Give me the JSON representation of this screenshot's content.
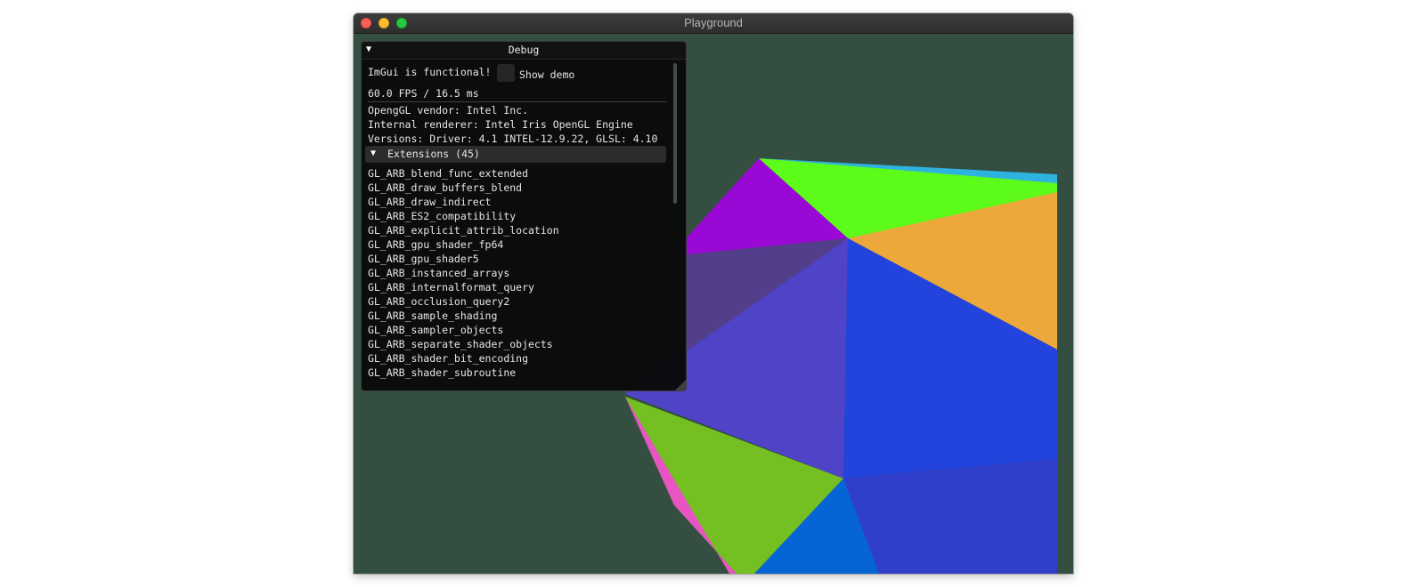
{
  "window": {
    "title": "Playground",
    "background_color": "#344e41",
    "controls": [
      "close-icon",
      "minimize-icon",
      "maximize-icon"
    ]
  },
  "debug_panel": {
    "title": "Debug",
    "status_text": "ImGui is functional!",
    "show_demo_label": "Show demo",
    "show_demo_checked": false,
    "fps_text": "60.0 FPS / 16.5 ms",
    "vendor_text": "OpengGL vendor: Intel Inc.",
    "renderer_text": "Internal renderer: Intel Iris OpenGL Engine",
    "versions_text": "Versions: Driver: 4.1 INTEL-12.9.22, GLSL: 4.10",
    "extensions_header": "Extensions (45)",
    "extensions": [
      "GL_ARB_blend_func_extended",
      "GL_ARB_draw_buffers_blend",
      "GL_ARB_draw_indirect",
      "GL_ARB_ES2_compatibility",
      "GL_ARB_explicit_attrib_location",
      "GL_ARB_gpu_shader_fp64",
      "GL_ARB_gpu_shader5",
      "GL_ARB_instanced_arrays",
      "GL_ARB_internalformat_query",
      "GL_ARB_occlusion_query2",
      "GL_ARB_sample_shading",
      "GL_ARB_sampler_objects",
      "GL_ARB_separate_shader_objects",
      "GL_ARB_shader_bit_encoding",
      "GL_ARB_shader_subroutine"
    ]
  },
  "scene": {
    "face_colors": [
      "#9a08d5",
      "#5cfb19",
      "#2db3de",
      "#eda83c",
      "#533e8b",
      "#4f43c7",
      "#2343dd",
      "#74bf21",
      "#e854c2",
      "#0565d6",
      "#2f3fcc"
    ]
  }
}
